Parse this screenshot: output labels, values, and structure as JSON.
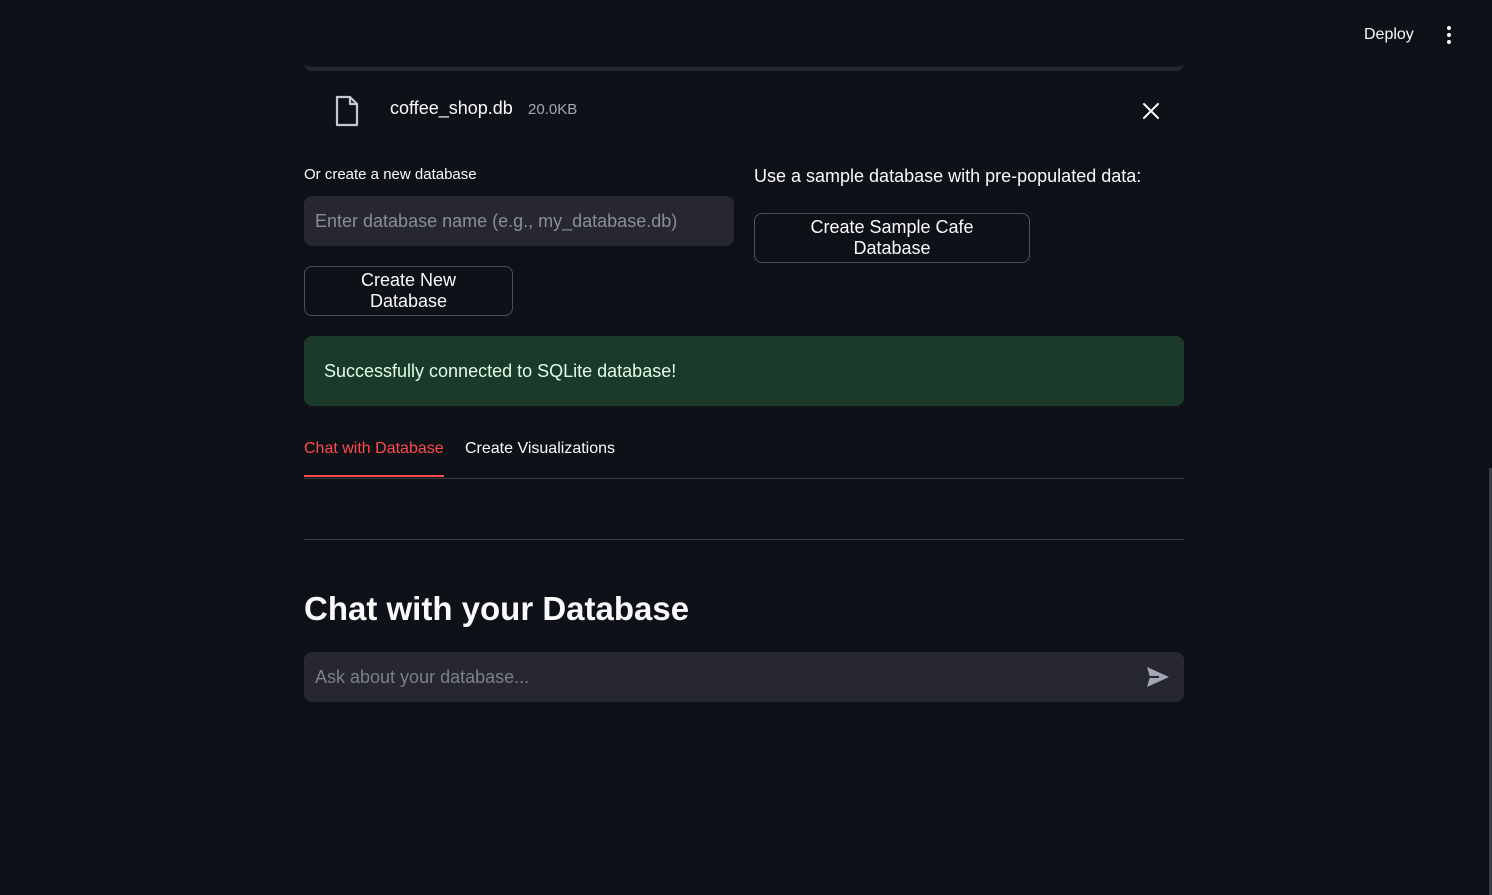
{
  "header": {
    "deploy_label": "Deploy",
    "menu_icon": "vertical-dots-icon"
  },
  "uploaded_file": {
    "name": "coffee_shop.db",
    "size": "20.0KB",
    "file_icon": "file-icon",
    "remove_icon": "close-icon"
  },
  "create_db": {
    "label": "Or create a new database",
    "input_placeholder": "Enter database name (e.g., my_database.db)",
    "input_value": "",
    "button_label": "Create New Database"
  },
  "sample_db": {
    "label": "Use a sample database with pre-populated data:",
    "button_label": "Create Sample Cafe Database"
  },
  "alert": {
    "message": "Successfully connected to SQLite database!",
    "color": "#1b3a29"
  },
  "tabs": [
    {
      "label": "Chat with Database",
      "active": true
    },
    {
      "label": "Create Visualizations",
      "active": false
    }
  ],
  "chat": {
    "heading": "Chat with your Database",
    "input_placeholder": "Ask about your database...",
    "send_icon": "send-icon"
  },
  "colors": {
    "background": "#0e1117",
    "accent": "#ff4b4b",
    "input_bg": "#262730"
  }
}
